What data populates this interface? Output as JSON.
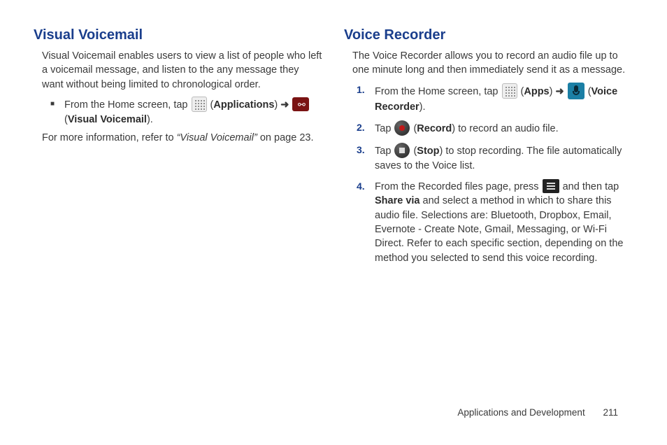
{
  "left": {
    "heading": "Visual Voicemail",
    "intro": "Visual Voicemail enables users to view a list of people who left a voicemail message, and listen to the any message they want without being limited to chronological order.",
    "bullet_prefix": "From the Home screen, tap ",
    "apps_label": "Applications",
    "vv_label": "Visual Voicemail",
    "more_info_pre": "For more information, refer to ",
    "more_info_link": "“Visual Voicemail”",
    "more_info_post": " on page 23."
  },
  "right": {
    "heading": "Voice Recorder",
    "intro": "The Voice Recorder allows you to record an audio file up to one minute long and then immediately send it as a message.",
    "step1_pre": "From the Home screen, tap ",
    "apps_label": "Apps",
    "vr_label": "Voice Recorder",
    "step2_pre": "Tap ",
    "record_label": "Record",
    "step2_post": " to record an audio file.",
    "step3_pre": "Tap ",
    "stop_label": "Stop",
    "step3_post": " to stop recording. The file automatically saves to the Voice list.",
    "step4_pre": "From the Recorded files page, press ",
    "step4_mid": " and then tap ",
    "share_label": "Share via",
    "step4_post": " and select a method in which to share this audio file. Selections are: Bluetooth, Dropbox, Email, Evernote - Create Note, Gmail, Messaging, or Wi-Fi Direct. Refer to each specific section, depending on the method you selected to send this voice recording."
  },
  "numbers": [
    "1.",
    "2.",
    "3.",
    "4."
  ],
  "arrow": "➜",
  "footer": {
    "section": "Applications and Development",
    "page": "211"
  }
}
